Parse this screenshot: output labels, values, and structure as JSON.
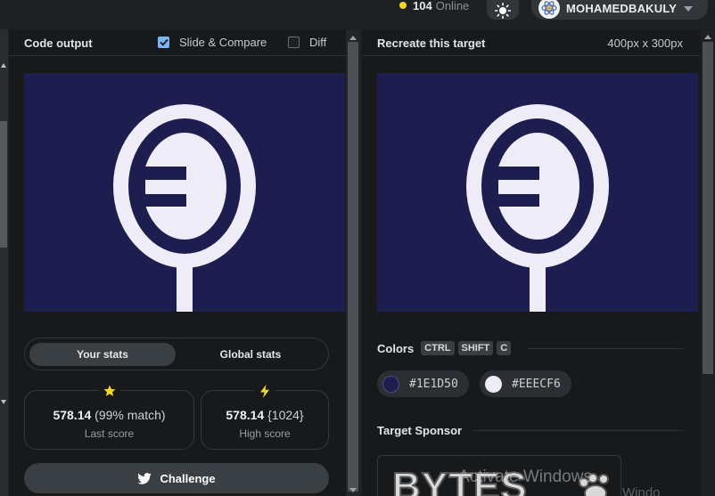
{
  "topbar": {
    "online_count": "104",
    "online_label": "Online",
    "username": "MOHAMEDBAKULY",
    "theme_icon": "sun-icon",
    "online_dot_color": "#f5d623"
  },
  "code_output": {
    "title": "Code output",
    "slide_compare_label": "Slide & Compare",
    "slide_compare_checked": true,
    "diff_label": "Diff",
    "diff_checked": false
  },
  "stats": {
    "tabs": [
      "Your stats",
      "Global stats"
    ],
    "active_tab": "Your stats",
    "last_score": {
      "score": "578.14",
      "detail": "(99% match)",
      "label": "Last score",
      "icon": "star-icon"
    },
    "high_score": {
      "score": "578.14",
      "detail": "{1024}",
      "label": "High score",
      "icon": "lightning-icon"
    },
    "challenge_label": "Challenge"
  },
  "target": {
    "title": "Recreate this target",
    "dimensions": "400px x 300px",
    "colors_title": "Colors",
    "shortcut_keys": [
      "CTRL",
      "SHIFT",
      "C"
    ],
    "colors": [
      {
        "hex": "#1E1D50"
      },
      {
        "hex": "#EEECF6"
      }
    ],
    "sponsor_title": "Target Sponsor",
    "sponsor_logo_text": "BYTES"
  },
  "overlay": {
    "activate_windows": "Activate Windows",
    "windows_fragment": "Windo"
  }
}
